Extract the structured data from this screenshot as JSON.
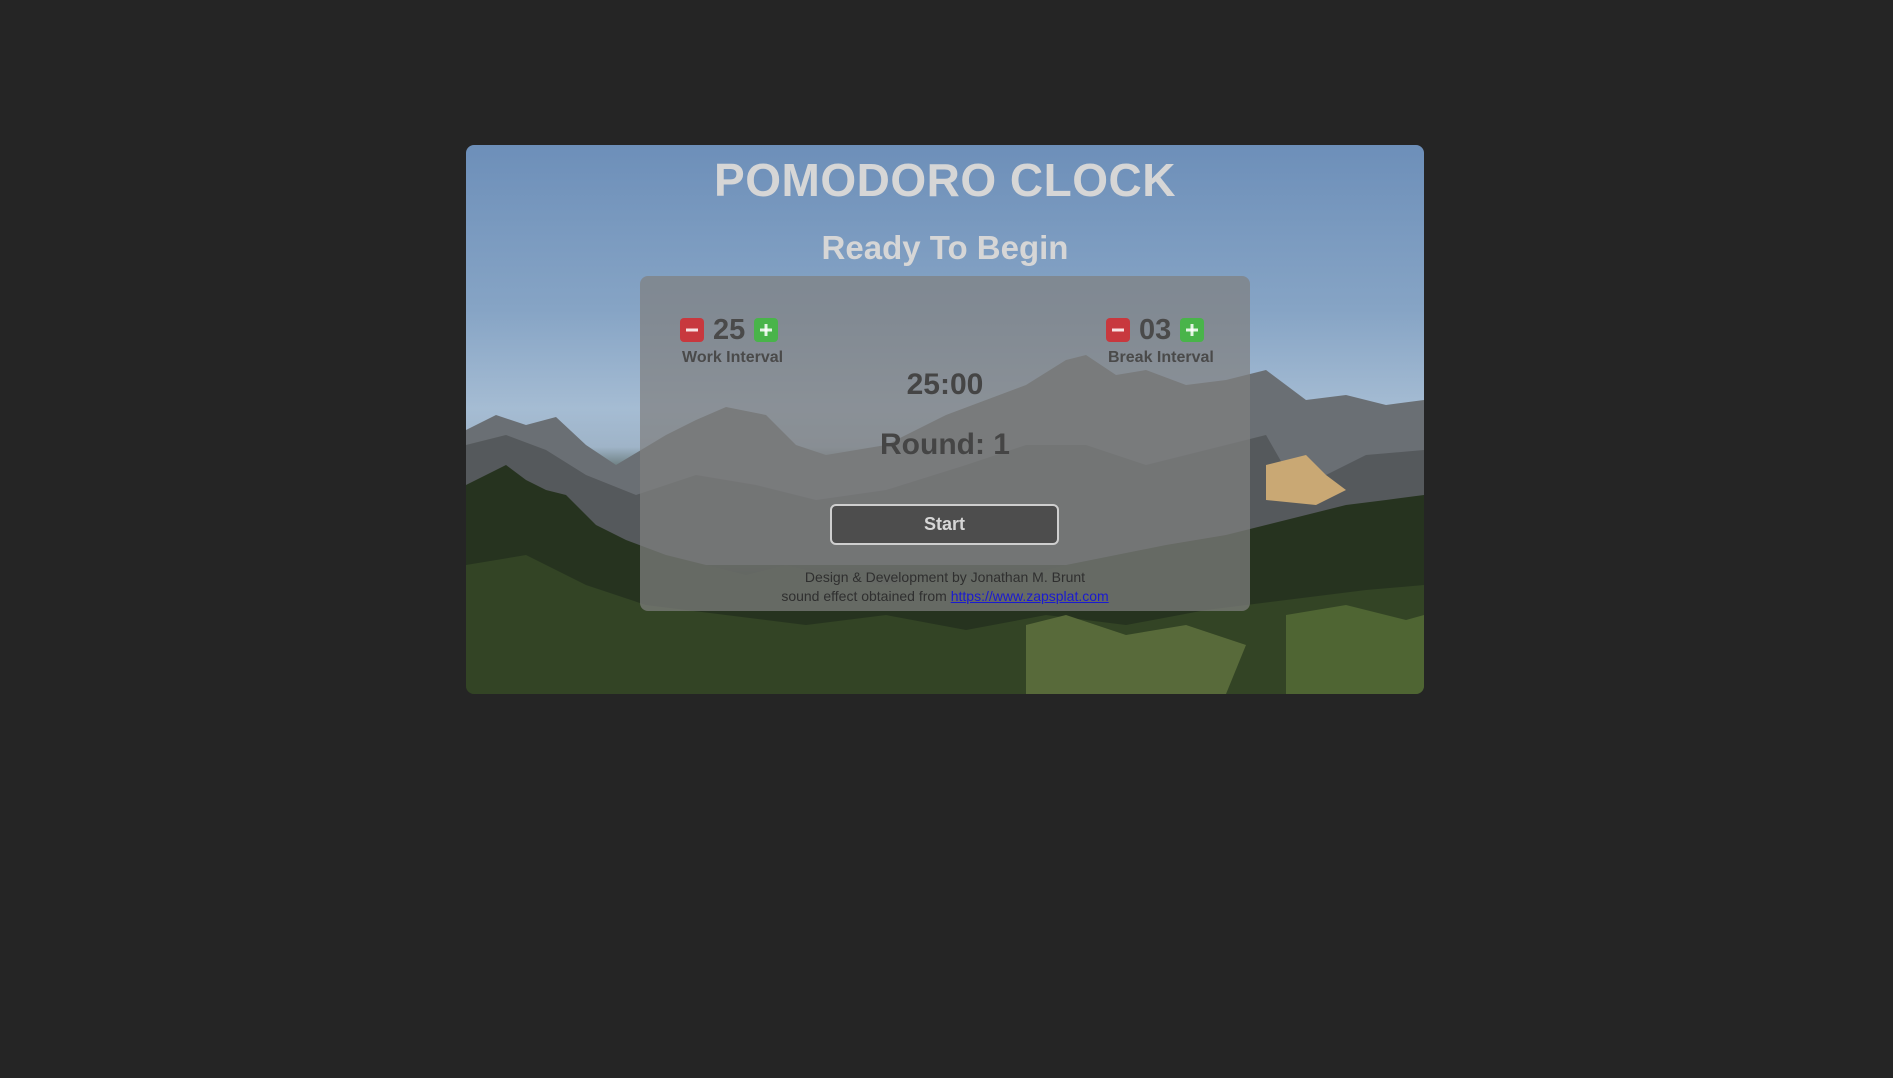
{
  "app": {
    "title": "POMODORO CLOCK",
    "status": "Ready To Begin"
  },
  "work_interval": {
    "value": "25",
    "label": "Work Interval"
  },
  "break_interval": {
    "value": "03",
    "label": "Break Interval"
  },
  "timer": {
    "display": "25:00",
    "round": "Round: 1"
  },
  "controls": {
    "start_label": "Start"
  },
  "credits": {
    "line1": "Design & Development by Jonathan M. Brunt",
    "line2_prefix": "sound effect obtained from ",
    "link_text": "https://www.zapsplat.com"
  },
  "icons": {
    "decrease": "minus-icon",
    "increase": "plus-icon"
  },
  "colors": {
    "page_bg": "#252525",
    "decrease_button": "#c8383e",
    "increase_button": "#49b44a",
    "link": "#1a1ad0"
  }
}
